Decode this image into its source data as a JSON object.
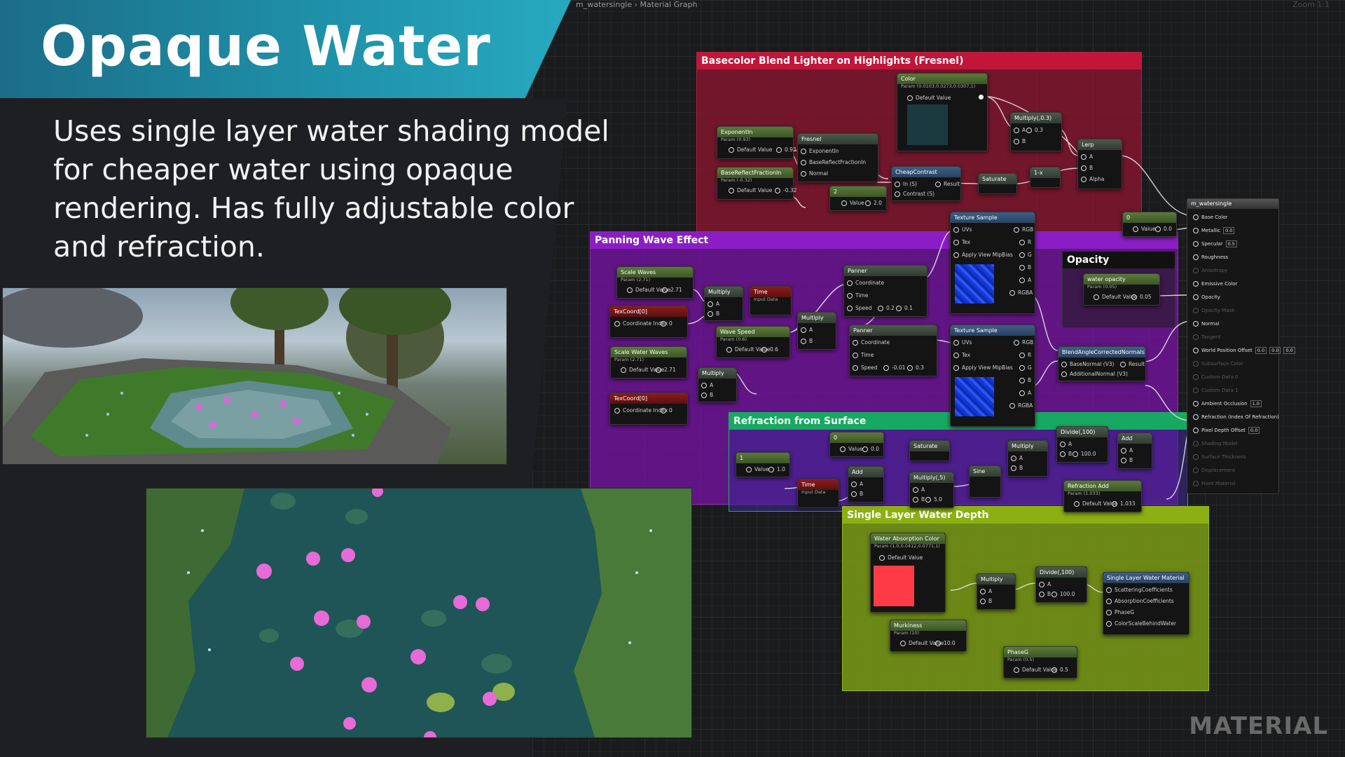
{
  "slide": {
    "title": "Opaque Water",
    "description": "Uses single layer water shading model for cheaper water using opaque rendering. Has fully adjustable color and refraction.",
    "watermark": "MATERIAL"
  },
  "editor": {
    "breadcrumb": "m_watersingle › Material Graph",
    "zoom": "Zoom 1:1"
  },
  "comments": {
    "basecolor": "Basecolor Blend Lighter on Highlights (Fresnel)",
    "panning": "Panning Wave Effect",
    "opacity": "Opacity",
    "refraction": "Refraction from Surface",
    "depth": "Single Layer Water Depth"
  },
  "nodes": {
    "color": {
      "title": "Color",
      "sub": "Param (0.0103,0.0273,0.0307,1)",
      "row": "Default Value"
    },
    "exponentin": {
      "title": "ExponentIn",
      "sub": "Param (0.93)",
      "row": "Default Value",
      "val": "0.93"
    },
    "baserefl": {
      "title": "BaseReflectFractionIn",
      "sub": "Param (-0.32)",
      "row": "Default Value",
      "val": "-0.32"
    },
    "fresnel": {
      "title": "Fresnel",
      "p1": "ExponentIn",
      "p2": "BaseReflectFractionIn",
      "p3": "Normal"
    },
    "cheapcontrast": {
      "title": "CheapContrast",
      "p1": "In (S)",
      "p2": "Contrast (S)",
      "out": "Result"
    },
    "const2": {
      "title": "2",
      "row": "Value",
      "val": "2.0"
    },
    "multiply03": {
      "title": "Multiply(,0.3)",
      "p1": "A",
      "v1": "0.3",
      "p2": "B"
    },
    "saturate1": {
      "title": "Saturate"
    },
    "onex": {
      "title": "1-x"
    },
    "lerp": {
      "title": "Lerp",
      "p1": "A",
      "p2": "B",
      "p3": "Alpha"
    },
    "const0top": {
      "title": "0",
      "row": "Value",
      "val": "0.0"
    },
    "texsample1": {
      "title": "Texture Sample",
      "p1": "UVs",
      "p2": "Tex",
      "p3": "Apply View MipBias",
      "o1": "RGB",
      "o2": "R",
      "o3": "G",
      "o4": "B",
      "o5": "A",
      "o6": "RGBA"
    },
    "texsample2": {
      "title": "Texture Sample",
      "p1": "UVs",
      "p2": "Tex",
      "p3": "Apply View MipBias",
      "o1": "RGB",
      "o2": "R",
      "o3": "G",
      "o4": "B",
      "o5": "A",
      "o6": "RGBA"
    },
    "scalewaves": {
      "title": "Scale Waves",
      "sub": "Param (2.71)",
      "row": "Default Value",
      "val": "2.71"
    },
    "texcoord1": {
      "title": "TexCoord[0]",
      "row": "Coordinate Index",
      "val": "0"
    },
    "scalewaterwaves": {
      "title": "Scale Water Waves",
      "sub": "Param (2.71)",
      "row": "Default Value",
      "val": "2.71"
    },
    "texcoord2": {
      "title": "TexCoord[0]",
      "row": "Coordinate Index",
      "val": "0"
    },
    "multiplyA": {
      "title": "Multiply",
      "p1": "A",
      "p2": "B"
    },
    "multiplyB": {
      "title": "Multiply",
      "p1": "A",
      "p2": "B"
    },
    "multiplyC": {
      "title": "Multiply",
      "p1": "A",
      "p2": "B"
    },
    "time1": {
      "title": "Time",
      "sub": "Input Data"
    },
    "wavespeed": {
      "title": "Wave Speed",
      "sub": "Param (0.6)",
      "row": "Default Value",
      "val": "0.6"
    },
    "panner1": {
      "title": "Panner",
      "p1": "Coordinate",
      "p2": "Time",
      "p3": "Speed",
      "x": "0.2",
      "y": "0.1"
    },
    "panner2": {
      "title": "Panner",
      "p1": "Coordinate",
      "p2": "Time",
      "p3": "Speed",
      "x": "-0.01",
      "y": "0.3"
    },
    "blend": {
      "title": "BlendAngleCorrectedNormals",
      "p1": "BaseNormal (V3)",
      "p2": "AdditionalNormal (V3)",
      "out": "Result"
    },
    "wateropacity": {
      "title": "water opacity",
      "sub": "Param (0.05)",
      "row": "Default Value",
      "val": "0.05"
    },
    "const0ref": {
      "title": "0",
      "row": "Value",
      "val": "0.0"
    },
    "const1ref": {
      "title": "1",
      "row": "Value",
      "val": "1.0"
    },
    "saturate2": {
      "title": "Saturate"
    },
    "add1": {
      "title": "Add",
      "p1": "A",
      "p2": "B"
    },
    "time2": {
      "title": "Time",
      "sub": "Input Data"
    },
    "multiply5": {
      "title": "Multiply(,5)",
      "p1": "A",
      "p2": "B",
      "v2": "5.0"
    },
    "sine": {
      "title": "Sine"
    },
    "multiplyR": {
      "title": "Multiply",
      "p1": "A",
      "p2": "B"
    },
    "divide100a": {
      "title": "Divide(,100)",
      "p1": "A",
      "p2": "B",
      "v2": "100.0"
    },
    "add2": {
      "title": "Add",
      "p1": "A",
      "p2": "B"
    },
    "refractionadd": {
      "title": "Refraction Add",
      "sub": "Param (1.033)",
      "row": "Default Value",
      "val": "1.033"
    },
    "absorption": {
      "title": "Water Absorption Color",
      "sub": "Param (1.0,0.0412,0.0771,1)",
      "row": "Default Value"
    },
    "multiplyD": {
      "title": "Multiply",
      "p1": "A",
      "p2": "B"
    },
    "divide100b": {
      "title": "Divide(,100)",
      "p1": "A",
      "p2": "B",
      "v2": "100.0"
    },
    "murkiness": {
      "title": "Murkiness",
      "sub": "Param (10)",
      "row": "Default Value",
      "val": "10.0"
    },
    "phaseg": {
      "title": "PhaseG",
      "sub": "Param (0.5)",
      "row": "Default Value",
      "val": "0.5"
    },
    "slwmat": {
      "title": "Single Layer Water Material",
      "p1": "ScatteringCoefficients",
      "p2": "AbsorptionCoefficients",
      "p3": "PhaseG",
      "p4": "ColorScaleBehindWater"
    }
  },
  "material_output": {
    "title": "m_watersingle",
    "rows": [
      {
        "label": "Base Color",
        "active": true
      },
      {
        "label": "Metallic",
        "val": "0.0",
        "active": true
      },
      {
        "label": "Specular",
        "val": "0.5",
        "active": true
      },
      {
        "label": "Roughness",
        "active": true
      },
      {
        "label": "Anisotropy",
        "active": false
      },
      {
        "label": "Emissive Color",
        "active": true
      },
      {
        "label": "Opacity",
        "active": true
      },
      {
        "label": "Opacity Mask",
        "active": false
      },
      {
        "label": "Normal",
        "active": true
      },
      {
        "label": "Tangent",
        "active": false
      },
      {
        "label": "World Position Offset",
        "x": "0.0",
        "y": "0.0",
        "z": "0.0",
        "active": true
      },
      {
        "label": "Subsurface Color",
        "active": false
      },
      {
        "label": "Custom Data 0",
        "active": false
      },
      {
        "label": "Custom Data 1",
        "active": false
      },
      {
        "label": "Ambient Occlusion",
        "val": "1.0",
        "active": true
      },
      {
        "label": "Refraction (Index Of Refraction)",
        "active": true
      },
      {
        "label": "Pixel Depth Offset",
        "val": "0.0",
        "active": true
      },
      {
        "label": "Shading Model",
        "active": false
      },
      {
        "label": "Surface Thickness",
        "active": false
      },
      {
        "label": "Displacement",
        "active": false
      },
      {
        "label": "Front Material",
        "active": false
      }
    ]
  },
  "colors": {
    "banner": "#1e90a8",
    "basecolor_comment": "#8a1430",
    "panning_comment": "#6a1694",
    "refraction_comment": "#14a060",
    "depth_comment": "#7a9a14",
    "absorption_swatch": "#ff3b47",
    "color_swatch": "#1a3a40"
  }
}
